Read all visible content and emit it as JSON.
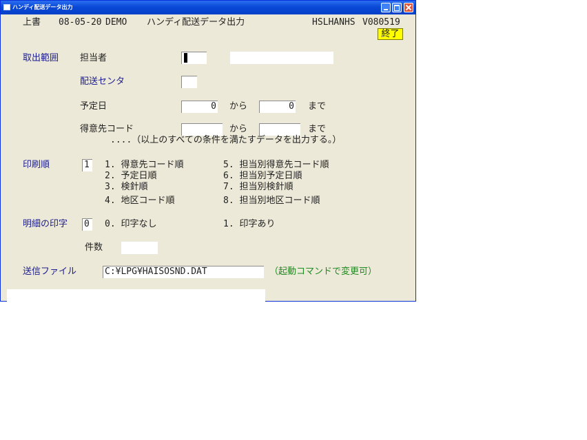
{
  "window": {
    "title": "ハンディ配送データ出力"
  },
  "header": {
    "mode": "上書",
    "date": "08-05-20",
    "user": "DEMO",
    "screen_title": "ハンディ配送データ出力",
    "program_id": "HSLHANHS",
    "version": "V080519",
    "exit_label": "終了"
  },
  "range": {
    "section_label": "取出範囲",
    "staff_label": "担当者",
    "staff_value": "",
    "staff_name": "",
    "center_label": "配送センタ",
    "center_value": "",
    "date_label": "予定日",
    "date_from": "0",
    "from_word": "から",
    "date_to": "0",
    "to_word": "まで",
    "customer_label": "得意先コード",
    "customer_from": "",
    "customer_to": "",
    "note": "....（以上のすべての条件を満たすデータを出力する。）"
  },
  "print_order": {
    "label": "印刷順",
    "value": "1",
    "options": [
      "1. 得意先コード順",
      "2. 予定日順",
      "3. 検針順",
      "4. 地区コード順",
      "5. 担当別得意先コード順",
      "6. 担当別予定日順",
      "7. 担当別検針順",
      "8. 担当別地区コード順"
    ]
  },
  "detail_print": {
    "label": "明細の印字",
    "value": "0",
    "option_0": "0. 印字なし",
    "option_1": "1. 印字あり"
  },
  "count": {
    "label": "件数",
    "value": ""
  },
  "send_file": {
    "label": "送信ファイル",
    "path": "C:¥LPG¥HAISOSND.DAT",
    "hint": "（起動コマンドで変更可）"
  },
  "status": ""
}
